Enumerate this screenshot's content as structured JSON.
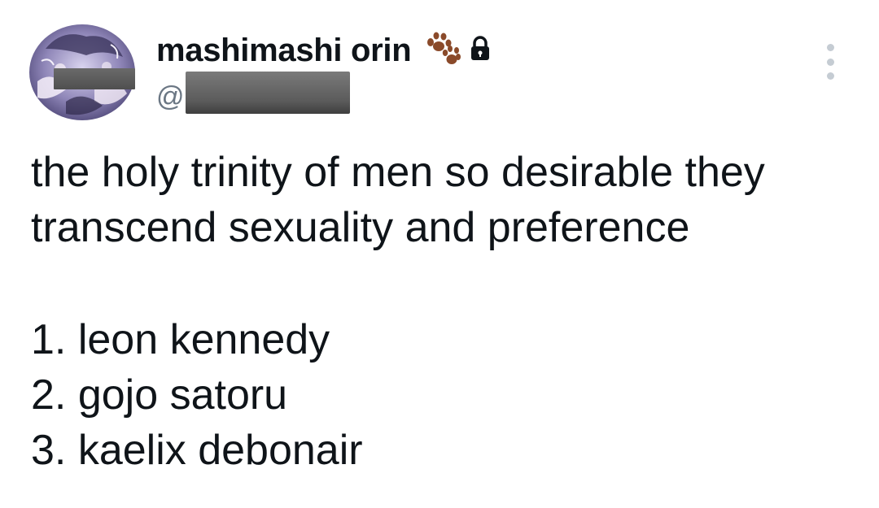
{
  "author": {
    "display_name": "mashimashi orin",
    "badge_emoji": "🐾",
    "protected_icon": "lock-icon",
    "handle_prefix": "@"
  },
  "tweet": {
    "lines": [
      "the holy trinity of men so desirable they",
      "transcend sexuality and preference"
    ],
    "list": [
      "1. leon kennedy",
      "2. gojo satoru",
      "3. kaelix debonair"
    ]
  },
  "colors": {
    "text": "#0f1419",
    "secondary": "#6b7784",
    "more_dots": "#c5ccd3",
    "paw": "#8a4a2a"
  }
}
